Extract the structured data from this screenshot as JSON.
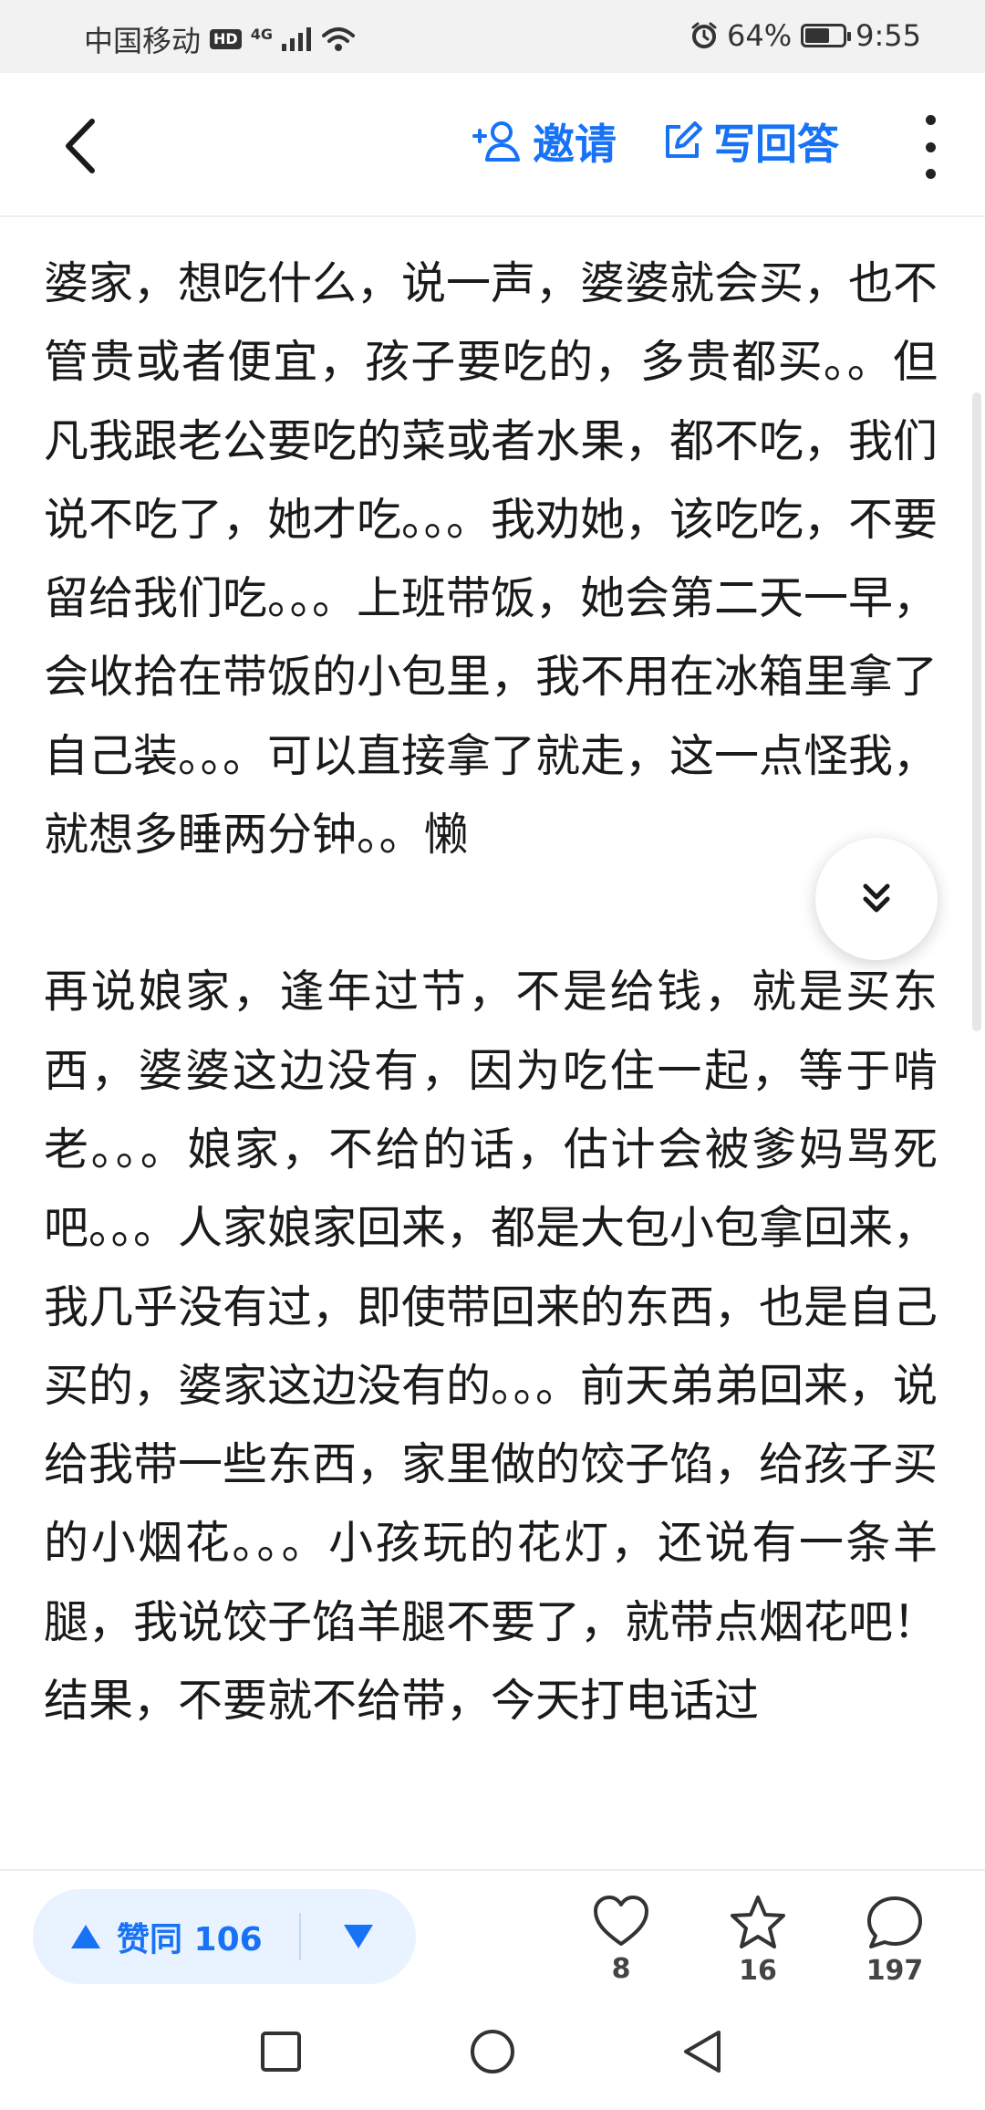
{
  "status_bar": {
    "carrier": "中国移动",
    "hd": "HD",
    "network": "4G",
    "battery": "64%",
    "battery_level": 0.64,
    "time": "9:55"
  },
  "header": {
    "invite_label": "邀请",
    "write_answer_label": "写回答"
  },
  "article": {
    "paragraphs": [
      "婆家，想吃什么，说一声，婆婆就会买，也不管贵或者便宜，孩子要吃的，多贵都买。。但凡我跟老公要吃的菜或者水果，都不吃，我们说不吃了，她才吃。。。我劝她，该吃吃，不要留给我们吃。。。上班带饭，她会第二天一早，会收拾在带饭的小包里，我不用在冰箱里拿了自己装。。。可以直接拿了就走，这一点怪我，就想多睡两分钟。。懒",
      "再说娘家，逢年过节，不是给钱，就是买东西，婆婆这边没有，因为吃住一起，等于啃老。。。娘家，不给的话，估计会被爹妈骂死吧。。。人家娘家回来，都是大包小包拿回来，我几乎没有过，即使带回来的东西，也是自己买的，婆家这边没有的。。。前天弟弟回来，说给我带一些东西，家里做的饺子馅，给孩子买的小烟花。。。小孩玩的花灯，还说有一条羊腿，我说饺子馅羊腿不要了，就带点烟花吧！结果，不要就不给带，今天打电话过"
    ]
  },
  "bottom_bar": {
    "upvote_label": "赞同 106",
    "like_count": "8",
    "favorite_count": "16",
    "comment_count": "197"
  },
  "colors": {
    "accent": "#1772f6",
    "vote_bg": "#e9f2ff"
  },
  "icons": {
    "back": "back-arrow-icon",
    "invite": "add-user-icon",
    "write": "edit-icon",
    "more": "more-vertical-icon",
    "scroll_down": "double-chevron-down-icon",
    "upvote": "triangle-up-icon",
    "downvote": "triangle-down-icon",
    "like": "heart-icon",
    "favorite": "star-icon",
    "comment": "comment-bubble-icon"
  }
}
